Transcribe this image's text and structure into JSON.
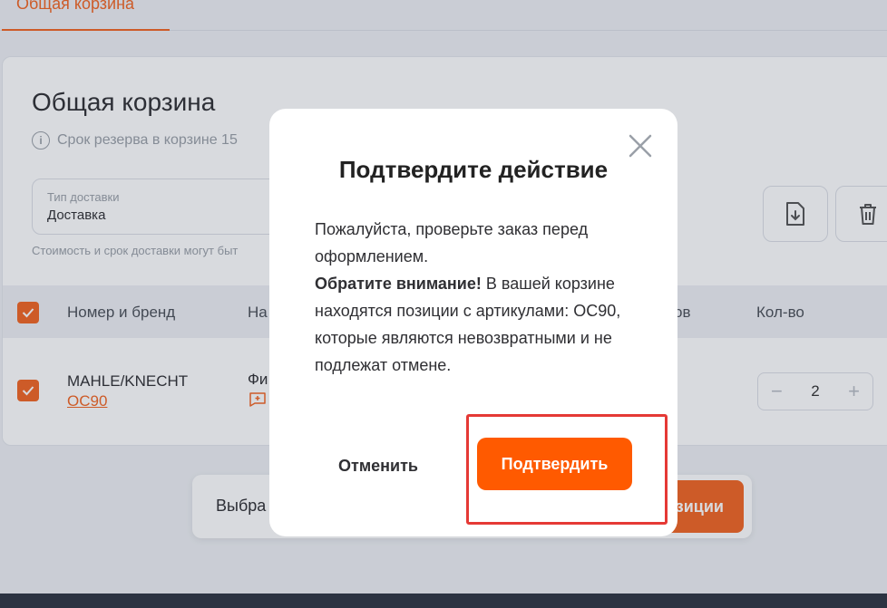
{
  "tabs": {
    "active_label": "Общая корзина"
  },
  "cart": {
    "title": "Общая корзина",
    "reserve_info": "Срок резерва в корзине 15",
    "delivery": {
      "label": "Тип доставки",
      "value": "Доставка"
    },
    "delivery_note": "Стоимость и срок доставки могут быт",
    "table_headers": {
      "number_brand": "Номер и бренд",
      "name": "На",
      "partial": "ов",
      "quantity": "Кол-во"
    },
    "row": {
      "brand": "MAHLE/KNECHT",
      "article": "OC90",
      "name": "Фи",
      "quantity": "2"
    }
  },
  "bottom_bar": {
    "label": "Выбра",
    "cta": "зиции"
  },
  "modal": {
    "title": "Подтвердите действие",
    "body_line1": "Пожалуйста, проверьте заказ перед оформлением.",
    "warning_bold": "Обратите внимание!",
    "warning_rest": " В вашей корзине находятся позиции с артикулами: OC90, которые являются невозвратными и не подлежат отмене.",
    "cancel_label": "Отменить",
    "confirm_label": "Подтвердить"
  },
  "colors": {
    "accent": "#f26522",
    "confirm": "#ff5a00",
    "highlight": "#e53935"
  }
}
